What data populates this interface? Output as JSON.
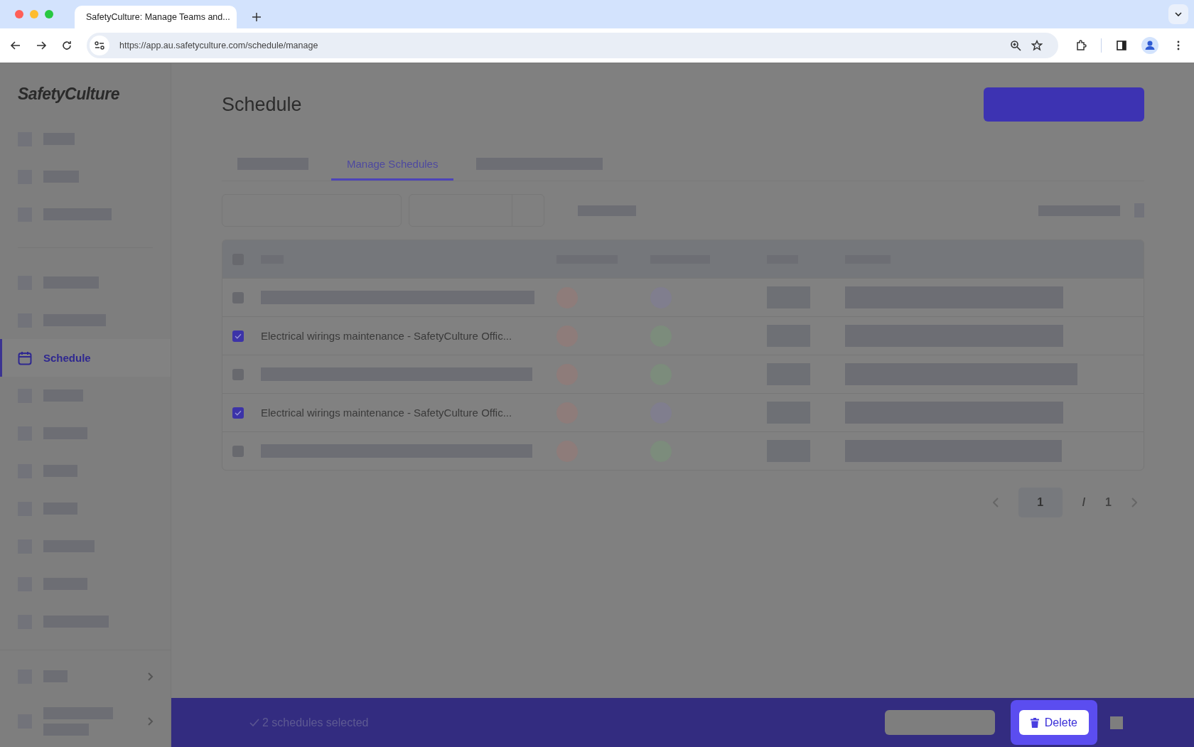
{
  "browser": {
    "tab_title": "SafetyCulture: Manage Teams and...",
    "url": "https://app.au.safetyculture.com/schedule/manage"
  },
  "sidebar": {
    "logo": "SafetyCulture",
    "items": [
      {
        "kind": "redacted",
        "selected": false
      },
      {
        "kind": "redacted",
        "selected": false
      },
      {
        "kind": "redacted",
        "selected": false
      },
      {
        "kind": "divider"
      },
      {
        "kind": "redacted",
        "selected": false
      },
      {
        "kind": "redacted",
        "selected": false
      },
      {
        "kind": "label",
        "label": "Schedule",
        "selected": true
      },
      {
        "kind": "redacted",
        "selected": false
      },
      {
        "kind": "redacted",
        "selected": false
      },
      {
        "kind": "redacted",
        "selected": false
      },
      {
        "kind": "redacted",
        "selected": false
      },
      {
        "kind": "redacted",
        "selected": false
      },
      {
        "kind": "redacted",
        "selected": false
      },
      {
        "kind": "redacted",
        "selected": false
      }
    ],
    "footer": [
      {
        "kind": "redacted",
        "selected": false
      },
      {
        "kind": "redacted",
        "selected": false
      }
    ]
  },
  "page": {
    "title": "Schedule"
  },
  "tabs": [
    {
      "kind": "redacted",
      "selected": false
    },
    {
      "kind": "label",
      "label": "Manage Schedules",
      "selected": true
    },
    {
      "kind": "redacted",
      "selected": false
    }
  ],
  "table": {
    "select_all_checked": false,
    "rows": [
      {
        "kind": "redacted",
        "checked": false,
        "dots": [
          {
            "color": "#8e7c7a"
          },
          {
            "color": "#807e8e"
          }
        ]
      },
      {
        "kind": "named",
        "checked": true,
        "name": "Electrical wirings maintenance - SafetyCulture Offic...",
        "dots": [
          {
            "color": "#8e7c7a"
          },
          {
            "color": "#7c8c7c"
          }
        ]
      },
      {
        "kind": "redacted",
        "checked": false,
        "dots": [
          {
            "color": "#8e7c7a"
          },
          {
            "color": "#7c8c7c"
          }
        ]
      },
      {
        "kind": "named",
        "checked": true,
        "name": "Electrical wirings maintenance - SafetyCulture Offic...",
        "dots": [
          {
            "color": "#8e7c7a"
          },
          {
            "color": "#807e8e"
          }
        ]
      },
      {
        "kind": "redacted",
        "checked": false,
        "dots": [
          {
            "color": "#8e7c7a"
          },
          {
            "color": "#7c8c7c"
          }
        ]
      }
    ]
  },
  "pagination": {
    "current": "1",
    "separator": "/",
    "total": "1"
  },
  "selection_bar": {
    "message": "2 schedules selected",
    "delete_label": "Delete"
  }
}
